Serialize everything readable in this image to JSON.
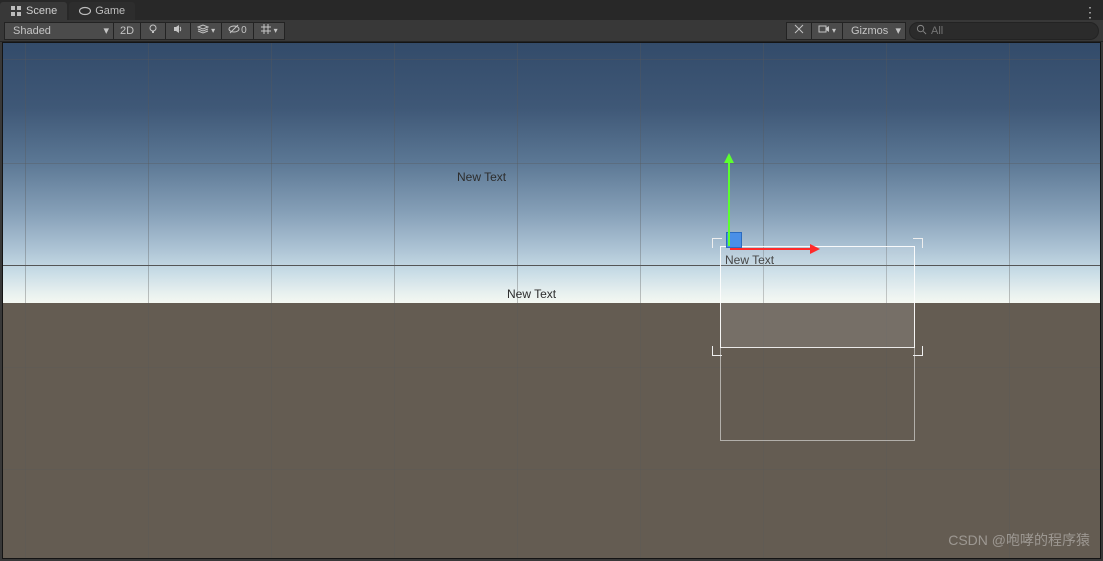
{
  "tabs": {
    "scene": "Scene",
    "game": "Game"
  },
  "toolbar": {
    "shading_mode": "Shaded",
    "mode_2d": "2D",
    "fx_label": "0",
    "gizmos_label": "Gizmos",
    "search_placeholder": "All"
  },
  "scene": {
    "text1": "New Text",
    "text2": "New Text",
    "text3": "New Text"
  },
  "watermark": "CSDN @咆哮的程序猿"
}
